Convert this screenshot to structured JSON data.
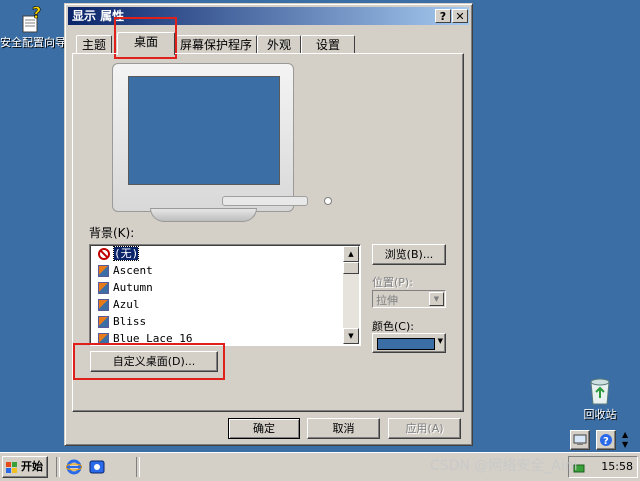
{
  "desktop": {
    "icons": [
      {
        "label": "安全配置向导",
        "icon": "security-wizard-icon"
      },
      {
        "label": "回收站",
        "icon": "recycle-bin-icon"
      }
    ],
    "background_color": "#3a6ea5"
  },
  "window": {
    "title": "显示 属性",
    "help_btn": "?",
    "close_btn": "✕",
    "tabs": [
      {
        "label": "主题"
      },
      {
        "label": "桌面",
        "active": true
      },
      {
        "label": "屏幕保护程序"
      },
      {
        "label": "外观"
      },
      {
        "label": "设置"
      }
    ],
    "background_label": "背景(K):",
    "backgrounds": [
      {
        "label": "(无)",
        "icon": "none-icon",
        "selected": true
      },
      {
        "label": "Ascent",
        "icon": "image-file-icon"
      },
      {
        "label": "Autumn",
        "icon": "image-file-icon"
      },
      {
        "label": "Azul",
        "icon": "image-file-icon"
      },
      {
        "label": "Bliss",
        "icon": "image-file-icon"
      },
      {
        "label": "Blue Lace 16",
        "icon": "image-file-icon"
      }
    ],
    "browse_label": "浏览(B)...",
    "position_label": "位置(P):",
    "position_value": "拉伸",
    "color_label": "颜色(C):",
    "color_value": "#3a6ea5",
    "customize_label": "自定义桌面(D)...",
    "ok_label": "确定",
    "cancel_label": "取消",
    "apply_label": "应用(A)"
  },
  "taskbar": {
    "start_label": "开始",
    "clock": "15:58"
  },
  "watermark": "CSDN @网络安全_Aini"
}
